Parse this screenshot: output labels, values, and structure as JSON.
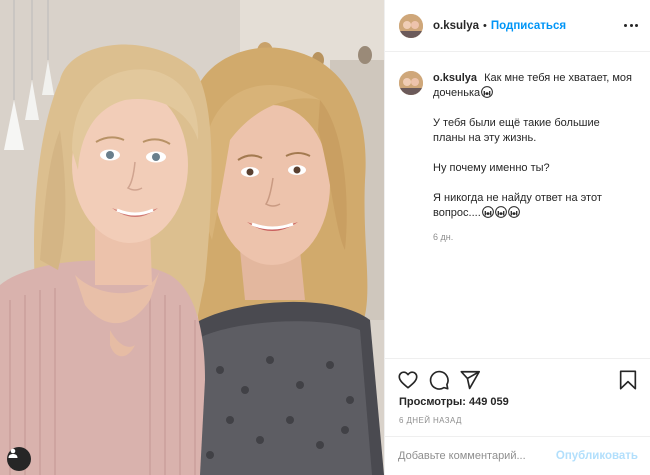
{
  "post": {
    "username": "o.ksulya",
    "separator": "•",
    "follow_label": "Подписаться",
    "caption_lines": [
      "Как мне тебя не хватает, моя доченька",
      "У тебя были ещё такие большие планы на эту жизнь.",
      "Ну почему именно ты?",
      "Я никогда не найду ответ на этот вопрос...."
    ],
    "caption_time": "6 дн.",
    "views_label": "Просмотры:",
    "views_count": "449 059",
    "date_label": "6 ДНЕЙ НАЗАД",
    "comment_placeholder": "Добавьте комментарий...",
    "publish_label": "Опубликовать"
  },
  "icons": {
    "like": "heart-icon",
    "comment": "comment-icon",
    "share": "send-icon",
    "save": "bookmark-icon",
    "more": "more-options-icon",
    "emoji": "crying-face-emoji-icon",
    "photo_account": "account-icon"
  },
  "colors": {
    "accent": "#0095f6",
    "accent_disabled": "#b2dffc",
    "text": "#262626",
    "muted": "#8e8e8e",
    "border": "#efefef"
  }
}
